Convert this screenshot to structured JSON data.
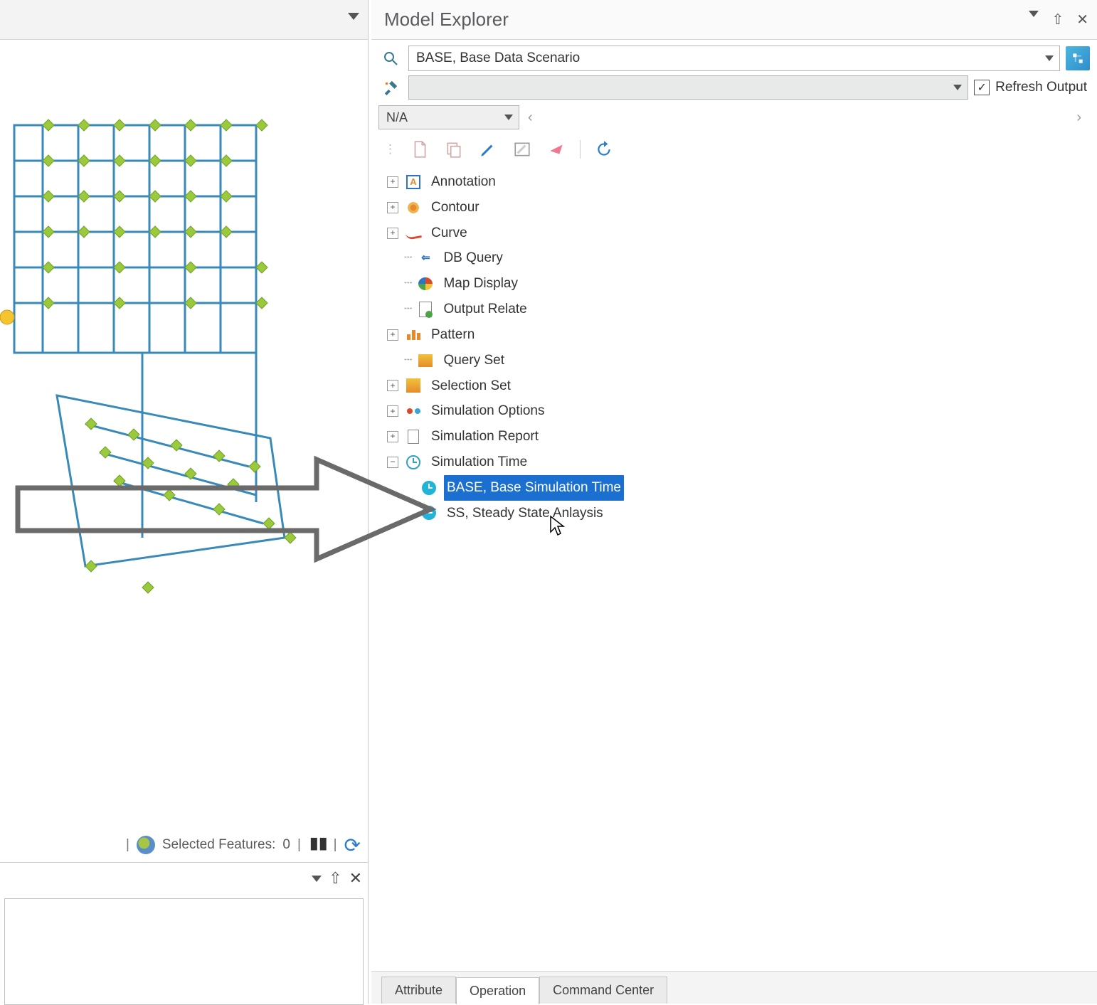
{
  "panel": {
    "title": "Model Explorer"
  },
  "scenario": {
    "value": "BASE, Base Data Scenario"
  },
  "refresh_output_label": "Refresh Output",
  "na_combo": "N/A",
  "status": {
    "selected_features_label": "Selected Features:",
    "selected_features_count": "0"
  },
  "tree": {
    "items": [
      {
        "label": "Annotation",
        "expandable": true
      },
      {
        "label": "Contour",
        "expandable": true
      },
      {
        "label": "Curve",
        "expandable": true
      },
      {
        "label": "DB Query",
        "expandable": false
      },
      {
        "label": "Map Display",
        "expandable": false
      },
      {
        "label": "Output Relate",
        "expandable": false
      },
      {
        "label": "Pattern",
        "expandable": true
      },
      {
        "label": "Query Set",
        "expandable": false
      },
      {
        "label": "Selection Set",
        "expandable": true
      },
      {
        "label": "Simulation Options",
        "expandable": true
      },
      {
        "label": "Simulation Report",
        "expandable": true
      },
      {
        "label": "Simulation Time",
        "expandable": true,
        "expanded": true
      }
    ],
    "sim_time_children": [
      {
        "label": "BASE, Base Simulation Time",
        "selected": true
      },
      {
        "label": "SS, Steady State Anlaysis",
        "selected": false
      }
    ]
  },
  "tabs": {
    "attribute": "Attribute",
    "operation": "Operation",
    "command_center": "Command Center"
  }
}
